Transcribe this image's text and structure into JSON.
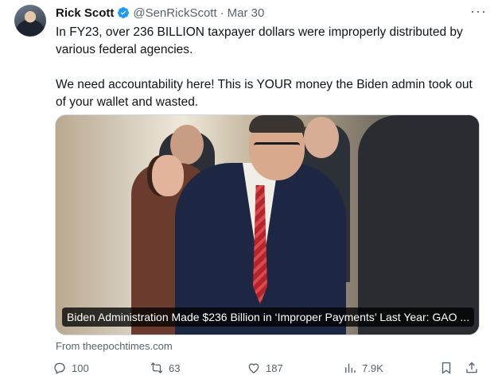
{
  "author": {
    "name": "Rick Scott",
    "handle": "@SenRickScott",
    "separator": "·",
    "date": "Mar 30",
    "avatar_icon": "avatar-photo",
    "verified_icon": "verified-badge-icon"
  },
  "menu": {
    "more_label": "···"
  },
  "tweet": {
    "paragraphs": [
      "In FY23, over 236 BILLION taxpayer dollars were improperly distributed by various federal agencies.",
      "We need accountability here! This is YOUR money the Biden admin took out of your wallet and wasted."
    ]
  },
  "card": {
    "caption": "Biden Administration Made $236 Billion in ‘Improper Payments’ Last Year: GAO ...",
    "source": "From theepochtimes.com"
  },
  "actions": {
    "replies": "100",
    "reposts": "63",
    "likes": "187",
    "views": "7.9K"
  },
  "colors": {
    "text": "#0f1419",
    "secondary": "#536471",
    "verified": "#1d9bf0",
    "border": "#cfd9de"
  }
}
